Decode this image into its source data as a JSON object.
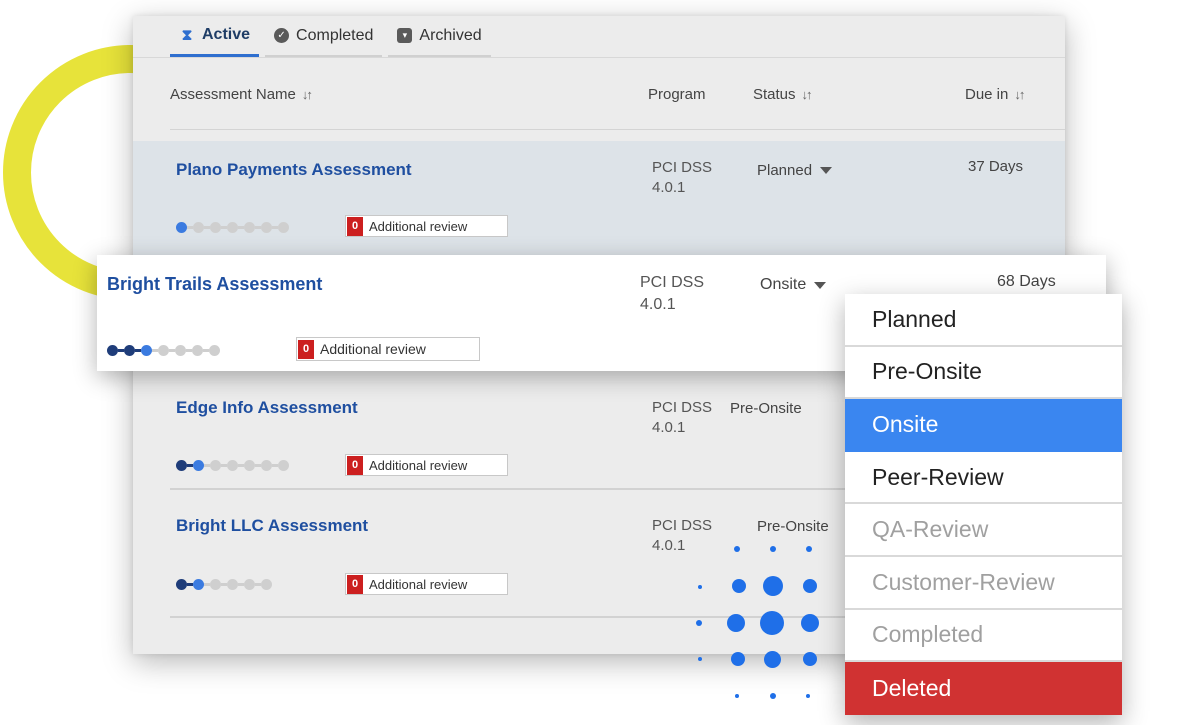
{
  "tabs": [
    {
      "label": "Active",
      "icon": "hourglass-icon"
    },
    {
      "label": "Completed",
      "icon": "check-circle-icon"
    },
    {
      "label": "Archived",
      "icon": "archive-icon"
    }
  ],
  "columns": {
    "name": "Assessment Name",
    "program": "Program",
    "status": "Status",
    "due": "Due in",
    "sort_icon": "↓↑"
  },
  "rows": [
    {
      "name": "Plano Payments Assessment",
      "program_line1": "PCI DSS",
      "program_line2": "4.0.1",
      "status": "Planned",
      "due": "37 Days",
      "review_count": "0",
      "review_label": "Additional review",
      "progress_done": 0,
      "progress_total": 7
    },
    {
      "name": "Bright Trails Assessment",
      "program_line1": "PCI DSS",
      "program_line2": "4.0.1",
      "status": "Onsite",
      "due": "68 Days",
      "review_count": "0",
      "review_label": "Additional review",
      "progress_done": 2,
      "progress_total": 7
    },
    {
      "name": "Edge Info Assessment",
      "program_line1": "PCI DSS",
      "program_line2": "4.0.1",
      "status": "Pre-Onsite",
      "due": "",
      "review_count": "0",
      "review_label": "Additional review",
      "progress_done": 1,
      "progress_total": 7
    },
    {
      "name": "Bright LLC Assessment",
      "program_line1": "PCI DSS",
      "program_line2": "4.0.1",
      "status": "Pre-Onsite",
      "due": "",
      "review_count": "0",
      "review_label": "Additional review",
      "progress_done": 1,
      "progress_total": 6
    }
  ],
  "status_dropdown": {
    "options": [
      "Planned",
      "Pre-Onsite",
      "Onsite",
      "Peer-Review",
      "QA-Review",
      "Customer-Review",
      "Completed",
      "Deleted"
    ],
    "selected": "Onsite",
    "disabled": [
      "QA-Review",
      "Customer-Review",
      "Completed"
    ],
    "danger": "Deleted"
  },
  "colors": {
    "accent": "#3a86f0",
    "link": "#1f4fa0",
    "danger": "#d03232",
    "badge": "#cc1f1f",
    "decor_ring": "#e7e33a",
    "decor_dots": "#1f6fe8"
  }
}
